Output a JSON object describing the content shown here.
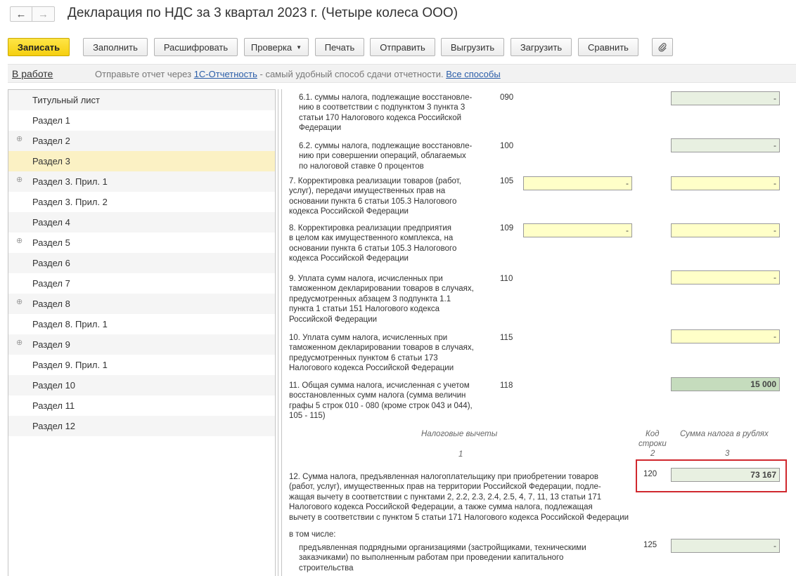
{
  "window": {
    "title": "Декларация по НДС за 3 квартал 2023 г. (Четыре колеса ООО)",
    "back_icon": "←",
    "forward_icon": "→"
  },
  "toolbar": {
    "save": "Записать",
    "fill": "Заполнить",
    "decode": "Расшифровать",
    "check": "Проверка",
    "print": "Печать",
    "send": "Отправить",
    "export": "Выгрузить",
    "import": "Загрузить",
    "compare": "Сравнить",
    "attach_icon": "paperclip-icon"
  },
  "status": {
    "state": "В работе",
    "message_prefix": "Отправьте отчет через",
    "link": "1С-Отчетность",
    "message_suffix": "- самый удобный способ сдачи отчетности.",
    "all_methods": "Все способы"
  },
  "sections": [
    {
      "label": "Титульный лист",
      "expandable": false
    },
    {
      "label": "Раздел 1",
      "expandable": false
    },
    {
      "label": "Раздел 2",
      "expandable": true
    },
    {
      "label": "Раздел 3",
      "expandable": false,
      "selected": true
    },
    {
      "label": "Раздел 3. Прил. 1",
      "expandable": true
    },
    {
      "label": "Раздел 3. Прил. 2",
      "expandable": false
    },
    {
      "label": "Раздел 4",
      "expandable": false
    },
    {
      "label": "Раздел 5",
      "expandable": true
    },
    {
      "label": "Раздел 6",
      "expandable": false
    },
    {
      "label": "Раздел 7",
      "expandable": false
    },
    {
      "label": "Раздел 8",
      "expandable": true
    },
    {
      "label": "Раздел 8. Прил. 1",
      "expandable": false
    },
    {
      "label": "Раздел 9",
      "expandable": true
    },
    {
      "label": "Раздел 9. Прил. 1",
      "expandable": false
    },
    {
      "label": "Раздел 10",
      "expandable": false
    },
    {
      "label": "Раздел 11",
      "expandable": false
    },
    {
      "label": "Раздел 12",
      "expandable": false
    }
  ],
  "form": {
    "rows": [
      {
        "desc": [
          "6.1. суммы налога, подлежащие восстановле-",
          "нию в соответствии с подпунктом 3 пункта 3",
          "статьи 170 Налогового кодекса Российской",
          "Федерации"
        ],
        "code": "090",
        "col1": null,
        "col2": "-"
      },
      {
        "desc": [
          "6.2. суммы налога, подлежащие восстановле-",
          "нию при совершении операций, облагаемых",
          "по налоговой ставке 0 процентов"
        ],
        "code": "100",
        "col1": null,
        "col2": "-"
      },
      {
        "desc": [
          "7. Корректировка реализации товаров (работ,",
          "услуг), передачи имущественных прав на",
          "основании пункта 6 статьи 105.3 Налогового",
          "кодекса Российской Федерации"
        ],
        "code": "105",
        "col1": "-",
        "col2": "-"
      },
      {
        "desc": [
          "8. Корректировка реализации предприятия",
          "в целом как имущественного комплекса, на",
          "основании пункта 6 статьи 105.3 Налогового",
          "кодекса Российской Федерации"
        ],
        "code": "109",
        "col1": "-",
        "col2": "-"
      },
      {
        "desc": [
          "9. Уплата сумм налога, исчисленных при",
          "таможенном декларировании товаров в случаях,",
          "предусмотренных абзацем 3 подпункта 1.1",
          "пункта 1 статьи 151 Налогового кодекса",
          "Российской Федерации"
        ],
        "code": "110",
        "col1": null,
        "col2": "-"
      },
      {
        "desc": [
          "10. Уплата сумм налога, исчисленных при",
          "таможенном декларировании товаров в случаях,",
          "предусмотренных пунктом 6 статьи 173",
          "Налогового кодекса Российской Федерации"
        ],
        "code": "115",
        "col1": null,
        "col2": "-"
      },
      {
        "desc": [
          "11. Общая сумма налога, исчисленная с учетом",
          "восстановленных сумм налога (сумма величин",
          "графы 5 строк 010 - 080 (кроме строк 043 и 044),",
          "105 - 115)"
        ],
        "code": "118",
        "col1": null,
        "col2": "15 000"
      }
    ],
    "deductions_header": {
      "title": "Налоговые вычеты",
      "code_col": [
        "Код",
        "строки"
      ],
      "amount_col": "Сумма налога в рублях",
      "num1": "1",
      "num2": "2",
      "num3": "3"
    },
    "row120": {
      "desc": [
        "12. Сумма налога, предъявленная налогоплательщику при приобретении товаров",
        "(работ, услуг), имущественных прав на территории Российской Федерации, подле-",
        "жащая вычету в соответствии с пунктами 2, 2.2, 2.3, 2.4, 2.5, 4, 7, 11, 13 статьи 171",
        "Налогового кодекса Российской Федерации, а также сумма налога, подлежащая",
        "вычету в соответствии с пунктом 5 статьи 171 Налогового кодекса Российской Федерации"
      ],
      "code": "120",
      "value": "73 167"
    },
    "including": "в том числе:",
    "row125": {
      "desc": [
        "предъявленная подрядными организациями (застройщиками, техническими",
        "заказчиками) по выполненным работам при проведении капитального",
        "строительства"
      ],
      "code": "125",
      "value": "-"
    }
  }
}
